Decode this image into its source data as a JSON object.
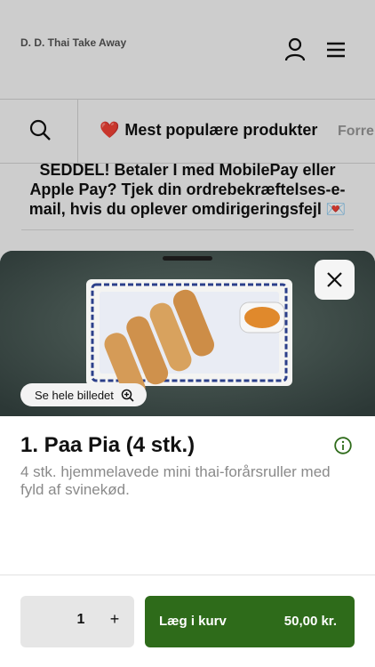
{
  "header": {
    "brand": "D. D. Thai Take Away"
  },
  "categories": {
    "active_emoji": "❤️",
    "active_label": "Mest populære produkter",
    "next_label": "Forre"
  },
  "notice": {
    "text": "SEDDEL! Betaler I med MobilePay eller Apple Pay? Tjek din ordrebekræftelses-e-mail, hvis du oplever omdirigeringsfejl 💌"
  },
  "product": {
    "view_image_label": "Se hele billedet",
    "title": "1. Paa Pia (4 stk.)",
    "description": "4 stk. hjemmelavede mini thai-forårsruller med fyld af svinekød."
  },
  "cart": {
    "quantity": "1",
    "plus": "+",
    "add_label": "Læg i kurv",
    "price": "50,00 kr."
  },
  "colors": {
    "accent_green": "#2e6b1a",
    "heart_red": "#d62828"
  },
  "icons": {
    "user": "user-icon",
    "menu": "hamburger-menu-icon",
    "search": "search-icon",
    "close": "close-icon",
    "zoom": "zoom-in-icon",
    "info": "info-icon"
  }
}
